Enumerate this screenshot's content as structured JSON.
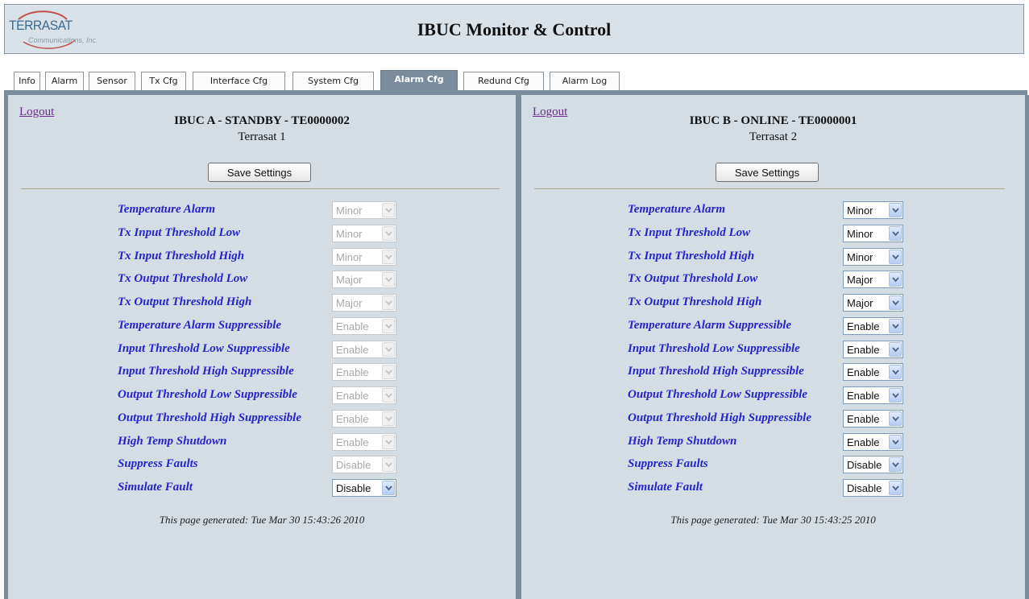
{
  "header": {
    "logo_text": "TERRASAT",
    "logo_subtext": "Communications, Inc.",
    "title": "IBUC Monitor & Control"
  },
  "tabs": [
    {
      "label": "Info"
    },
    {
      "label": "Alarm"
    },
    {
      "label": "Sensor"
    },
    {
      "label": "Tx Cfg"
    },
    {
      "label": "Interface Cfg"
    },
    {
      "label": "System Cfg"
    },
    {
      "label": "Alarm Cfg",
      "active": true
    },
    {
      "label": "Redund Cfg"
    },
    {
      "label": "Alarm Log"
    }
  ],
  "panels": [
    {
      "logout_label": "Logout",
      "unit_title": "IBUC A - STANDBY - TE0000002",
      "unit_name": "Terrasat 1",
      "save_label": "Save Settings",
      "rows": [
        {
          "label": "Temperature Alarm",
          "value": "Minor",
          "enabled": false
        },
        {
          "label": "Tx Input Threshold Low",
          "value": "Minor",
          "enabled": false
        },
        {
          "label": "Tx Input Threshold High",
          "value": "Minor",
          "enabled": false
        },
        {
          "label": "Tx Output Threshold Low",
          "value": "Major",
          "enabled": false
        },
        {
          "label": "Tx Output Threshold High",
          "value": "Major",
          "enabled": false
        },
        {
          "label": "Temperature Alarm Suppressible",
          "value": "Enable",
          "enabled": false
        },
        {
          "label": "Input Threshold Low Suppressible",
          "value": "Enable",
          "enabled": false
        },
        {
          "label": "Input Threshold High Suppressible",
          "value": "Enable",
          "enabled": false
        },
        {
          "label": "Output Threshold Low Suppressible",
          "value": "Enable",
          "enabled": false
        },
        {
          "label": "Output Threshold High Suppressible",
          "value": "Enable",
          "enabled": false
        },
        {
          "label": "High Temp Shutdown",
          "value": "Enable",
          "enabled": false
        },
        {
          "label": "Suppress Faults",
          "value": "Disable",
          "enabled": false
        },
        {
          "label": "Simulate Fault",
          "value": "Disable",
          "enabled": true
        }
      ],
      "generated": "This page generated: Tue Mar 30 15:43:26 2010"
    },
    {
      "logout_label": "Logout",
      "unit_title": "IBUC B - ONLINE - TE0000001",
      "unit_name": "Terrasat 2",
      "save_label": "Save Settings",
      "rows": [
        {
          "label": "Temperature Alarm",
          "value": "Minor",
          "enabled": true
        },
        {
          "label": "Tx Input Threshold Low",
          "value": "Minor",
          "enabled": true
        },
        {
          "label": "Tx Input Threshold High",
          "value": "Minor",
          "enabled": true
        },
        {
          "label": "Tx Output Threshold Low",
          "value": "Major",
          "enabled": true
        },
        {
          "label": "Tx Output Threshold High",
          "value": "Major",
          "enabled": true
        },
        {
          "label": "Temperature Alarm Suppressible",
          "value": "Enable",
          "enabled": true
        },
        {
          "label": "Input Threshold Low Suppressible",
          "value": "Enable",
          "enabled": true
        },
        {
          "label": "Input Threshold High Suppressible",
          "value": "Enable",
          "enabled": true
        },
        {
          "label": "Output Threshold Low Suppressible",
          "value": "Enable",
          "enabled": true
        },
        {
          "label": "Output Threshold High Suppressible",
          "value": "Enable",
          "enabled": true
        },
        {
          "label": "High Temp Shutdown",
          "value": "Enable",
          "enabled": true
        },
        {
          "label": "Suppress Faults",
          "value": "Disable",
          "enabled": true
        },
        {
          "label": "Simulate Fault",
          "value": "Disable",
          "enabled": true
        }
      ],
      "generated": "This page generated: Tue Mar 30 15:43:25 2010"
    }
  ]
}
